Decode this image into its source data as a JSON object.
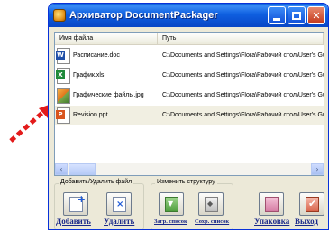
{
  "window": {
    "title": "Архиватор DocumentPackager"
  },
  "list": {
    "columns": {
      "name": "Имя файла",
      "path": "Путь"
    },
    "rows": [
      {
        "name": "Расписание.doc",
        "path": "C:\\Documents and Settings\\Flora\\Рабочий стол\\User's Guide",
        "icon": "word-document-icon",
        "selected": false
      },
      {
        "name": "График.xls",
        "path": "C:\\Documents and Settings\\Flora\\Рабочий стол\\User's Guide",
        "icon": "excel-spreadsheet-icon",
        "selected": false
      },
      {
        "name": "Графические файлы.jpg",
        "path": "C:\\Documents and Settings\\Flora\\Рабочий стол\\User's Guide",
        "icon": "image-file-icon",
        "selected": false
      },
      {
        "name": "Revision.ppt",
        "path": "C:\\Documents and Settings\\Flora\\Рабочий стол\\User's Guide",
        "icon": "powerpoint-presentation-icon",
        "selected": true
      }
    ]
  },
  "toolbar": {
    "group_files_label": "Добавить/Удалить файл",
    "group_structure_label": "Изменить структуру",
    "add_label": "Добавить",
    "delete_label": "Удалить",
    "load_list_label": "Загр. список",
    "save_list_label": "Сохр. список",
    "pack_label": "Упаковка",
    "exit_label": "Выход"
  },
  "colors": {
    "titlebar": "#0846c6",
    "selection": "#f1efe2",
    "pointer_arrow": "#e31b1b",
    "button_text": "#1b2a8a"
  }
}
